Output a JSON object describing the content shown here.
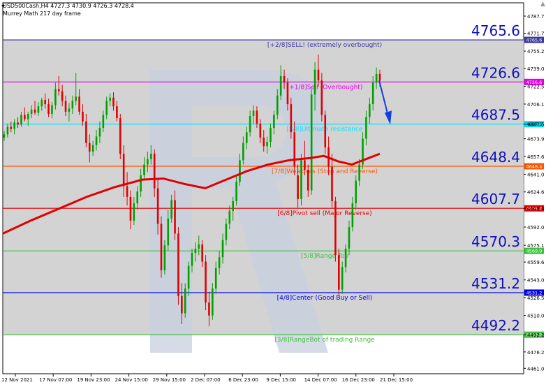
{
  "header": {
    "symbol_line": "USD500Cash,H4  4727.3 4730.9 4726.3 4728.4",
    "indicator_line": "Murrey Math 217 day frame"
  },
  "chart_data": {
    "type": "candlestick",
    "symbol": "USD500Cash",
    "timeframe": "H4",
    "ohlc": [
      4727.3,
      4730.9,
      4726.3,
      4728.4
    ],
    "indicator": "Murrey Math 217 day frame",
    "ylim": [
      4456,
      4800
    ],
    "y_ticks": [
      4461.0,
      4476.2,
      4492.2,
      4510.0,
      4526.5,
      4543.0,
      4559.6,
      4575.1,
      4592.0,
      4609.4,
      4624.6,
      4641.0,
      4657.6,
      4673.9,
      4687.5,
      4706.1,
      4722.5,
      4739.0,
      4755.2,
      4771.7,
      4787.7
    ],
    "x_ticks": [
      "12 Nov 2021",
      "17 Nov 07:00",
      "19 Nov 23:00",
      "24 Nov 15:00",
      "29 Nov 15:00",
      "2 Dec 07:00",
      "6 Dec 23:00",
      "9 Dec 15:00",
      "14 Dec 07:00",
      "16 Dec 23:00",
      "21 Dec 15:00"
    ],
    "levels": [
      {
        "value": 4765.6,
        "big_label": "4765.6",
        "tag": "4765.6",
        "text": "[+2/8]SELL! (extremely overbought)",
        "color": "#3a3aa0"
      },
      {
        "value": 4726.6,
        "big_label": "4726.6",
        "tag": "4726.6",
        "text": "[+1/8]Sell (Overbought)",
        "color": "#e000e0"
      },
      {
        "value": 4687.5,
        "big_label": "4687.5",
        "tag": "4687.5",
        "text": "[8/8]Ultimate resistance",
        "color": "#00e5ff"
      },
      {
        "value": 4648.4,
        "big_label": "4648.4",
        "tag": "4648.4",
        "text": "[7/8]Weak res (Stop and Reverse)",
        "color": "#ff5500"
      },
      {
        "value": 4609.4,
        "big_label": "4607.7",
        "tag": "4609.4",
        "text": "[6/8]Pivot sell (Major Reverse)",
        "color": "#e00000"
      },
      {
        "value": 4569.9,
        "big_label": "4570.3",
        "tag": "4569.9",
        "text": "[5/8]Range Top",
        "color": "#40c040"
      },
      {
        "value": 4531.2,
        "big_label": "4531.2",
        "tag": "4531.2",
        "text": "[4/8]Center (Good Buy or Sell)",
        "color": "#0000e0"
      },
      {
        "value": 4492.2,
        "big_label": "4492.2",
        "tag": "4492.2",
        "text": "[3/8]RangeBot of trading Range",
        "color": "#40c040"
      }
    ],
    "moving_average": {
      "color": "#e00000",
      "x": [
        0,
        40,
        80,
        120,
        160,
        200,
        230,
        260,
        290,
        320,
        350,
        380,
        410,
        440,
        460,
        480,
        500,
        520,
        540
      ],
      "y": [
        4586,
        4598,
        4609,
        4620,
        4629,
        4636,
        4637,
        4632,
        4628,
        4636,
        4644,
        4650,
        4654,
        4656,
        4658,
        4653,
        4650,
        4655,
        4660
      ]
    },
    "candles": [
      [
        4675,
        4681,
        4672,
        4678
      ],
      [
        4678,
        4688,
        4675,
        4685
      ],
      [
        4685,
        4690,
        4680,
        4683
      ],
      [
        4683,
        4692,
        4678,
        4689
      ],
      [
        4689,
        4694,
        4684,
        4687
      ],
      [
        4687,
        4699,
        4685,
        4696
      ],
      [
        4696,
        4703,
        4690,
        4692
      ],
      [
        4692,
        4699,
        4686,
        4697
      ],
      [
        4697,
        4705,
        4693,
        4701
      ],
      [
        4701,
        4709,
        4696,
        4698
      ],
      [
        4698,
        4708,
        4695,
        4704
      ],
      [
        4704,
        4712,
        4700,
        4710
      ],
      [
        4710,
        4716,
        4702,
        4706
      ],
      [
        4706,
        4711,
        4694,
        4697
      ],
      [
        4697,
        4708,
        4693,
        4705
      ],
      [
        4705,
        4726,
        4701,
        4720
      ],
      [
        4720,
        4732,
        4714,
        4718
      ],
      [
        4718,
        4724,
        4704,
        4709
      ],
      [
        4709,
        4714,
        4695,
        4699
      ],
      [
        4699,
        4707,
        4690,
        4702
      ],
      [
        4702,
        4714,
        4697,
        4709
      ],
      [
        4709,
        4735,
        4705,
        4713
      ],
      [
        4713,
        4720,
        4696,
        4699
      ],
      [
        4699,
        4706,
        4686,
        4690
      ],
      [
        4690,
        4697,
        4666,
        4670
      ],
      [
        4670,
        4678,
        4652,
        4662
      ],
      [
        4662,
        4672,
        4658,
        4668
      ],
      [
        4668,
        4682,
        4663,
        4676
      ],
      [
        4676,
        4690,
        4670,
        4684
      ],
      [
        4684,
        4700,
        4680,
        4696
      ],
      [
        4696,
        4713,
        4692,
        4709
      ],
      [
        4709,
        4716,
        4704,
        4712
      ],
      [
        4712,
        4717,
        4700,
        4704
      ],
      [
        4704,
        4709,
        4690,
        4693
      ],
      [
        4693,
        4697,
        4655,
        4660
      ],
      [
        4660,
        4668,
        4620,
        4630
      ],
      [
        4630,
        4643,
        4612,
        4620
      ],
      [
        4620,
        4626,
        4590,
        4598
      ],
      [
        4598,
        4620,
        4594,
        4614
      ],
      [
        4614,
        4630,
        4608,
        4625
      ],
      [
        4625,
        4646,
        4620,
        4640
      ],
      [
        4640,
        4657,
        4635,
        4650
      ],
      [
        4650,
        4662,
        4643,
        4655
      ],
      [
        4655,
        4668,
        4650,
        4660
      ],
      [
        4660,
        4664,
        4620,
        4628
      ],
      [
        4628,
        4636,
        4585,
        4595
      ],
      [
        4595,
        4602,
        4545,
        4552
      ],
      [
        4552,
        4580,
        4548,
        4575
      ],
      [
        4575,
        4608,
        4570,
        4600
      ],
      [
        4600,
        4622,
        4596,
        4617
      ],
      [
        4617,
        4626,
        4580,
        4586
      ],
      [
        4586,
        4592,
        4520,
        4528
      ],
      [
        4528,
        4540,
        4502,
        4512
      ],
      [
        4512,
        4540,
        4508,
        4535
      ],
      [
        4535,
        4560,
        4528,
        4556
      ],
      [
        4556,
        4572,
        4550,
        4568
      ],
      [
        4568,
        4578,
        4560,
        4572
      ],
      [
        4572,
        4584,
        4566,
        4576
      ],
      [
        4576,
        4580,
        4555,
        4560
      ],
      [
        4560,
        4566,
        4515,
        4522
      ],
      [
        4522,
        4532,
        4500,
        4510
      ],
      [
        4510,
        4540,
        4506,
        4535
      ],
      [
        4535,
        4560,
        4530,
        4554
      ],
      [
        4554,
        4570,
        4548,
        4564
      ],
      [
        4564,
        4586,
        4558,
        4580
      ],
      [
        4580,
        4600,
        4575,
        4595
      ],
      [
        4595,
        4612,
        4590,
        4607
      ],
      [
        4607,
        4620,
        4598,
        4616
      ],
      [
        4616,
        4640,
        4612,
        4634
      ],
      [
        4634,
        4660,
        4630,
        4654
      ],
      [
        4654,
        4676,
        4650,
        4670
      ],
      [
        4670,
        4685,
        4664,
        4680
      ],
      [
        4680,
        4700,
        4676,
        4695
      ],
      [
        4695,
        4705,
        4688,
        4700
      ],
      [
        4700,
        4704,
        4684,
        4688
      ],
      [
        4688,
        4692,
        4670,
        4675
      ],
      [
        4675,
        4682,
        4662,
        4667
      ],
      [
        4667,
        4676,
        4660,
        4671
      ],
      [
        4671,
        4688,
        4666,
        4684
      ],
      [
        4684,
        4700,
        4678,
        4696
      ],
      [
        4696,
        4720,
        4692,
        4714
      ],
      [
        4714,
        4742,
        4710,
        4732
      ],
      [
        4732,
        4738,
        4720,
        4726
      ],
      [
        4726,
        4730,
        4700,
        4706
      ],
      [
        4706,
        4712,
        4674,
        4680
      ],
      [
        4680,
        4690,
        4640,
        4648
      ],
      [
        4640,
        4650,
        4610,
        4618
      ],
      [
        4618,
        4660,
        4612,
        4654
      ],
      [
        4654,
        4672,
        4640,
        4645
      ],
      [
        4645,
        4650,
        4620,
        4626
      ],
      [
        4626,
        4720,
        4622,
        4715
      ],
      [
        4715,
        4745,
        4700,
        4738
      ],
      [
        4738,
        4752,
        4722,
        4728
      ],
      [
        4728,
        4735,
        4690,
        4696
      ],
      [
        4696,
        4700,
        4660,
        4666
      ],
      [
        4666,
        4676,
        4640,
        4648
      ],
      [
        4648,
        4660,
        4610,
        4616
      ],
      [
        4616,
        4620,
        4560,
        4566
      ],
      [
        4566,
        4572,
        4528,
        4534
      ],
      [
        4534,
        4560,
        4530,
        4555
      ],
      [
        4555,
        4576,
        4550,
        4572
      ],
      [
        4572,
        4598,
        4566,
        4592
      ],
      [
        4592,
        4620,
        4588,
        4614
      ],
      [
        4614,
        4640,
        4608,
        4635
      ],
      [
        4635,
        4655,
        4630,
        4650
      ],
      [
        4650,
        4680,
        4646,
        4674
      ],
      [
        4674,
        4700,
        4668,
        4694
      ],
      [
        4694,
        4712,
        4688,
        4706
      ],
      [
        4706,
        4732,
        4700,
        4726
      ],
      [
        4726,
        4740,
        4720,
        4734
      ],
      [
        4734,
        4738,
        4722,
        4728
      ]
    ]
  }
}
